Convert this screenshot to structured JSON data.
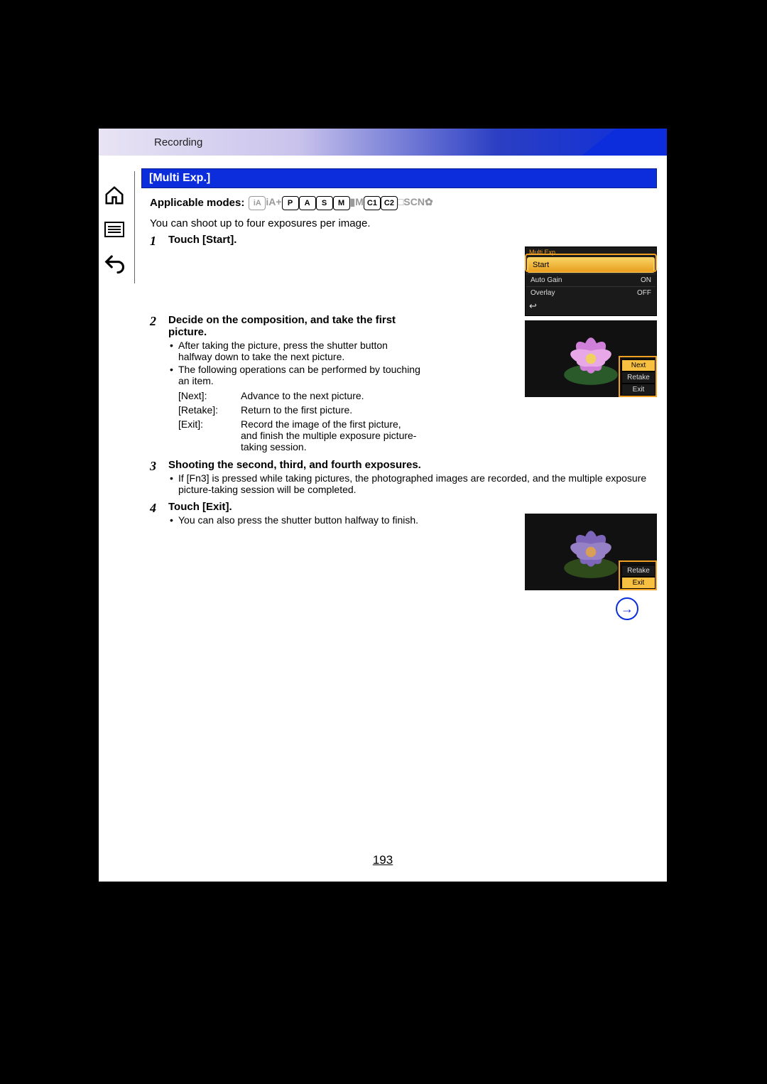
{
  "header": {
    "section": "Recording"
  },
  "title": "[Multi Exp.]",
  "modes_label": "Applicable modes:",
  "modes": [
    {
      "label": "iA",
      "on": false,
      "border": true
    },
    {
      "label": "iA+",
      "on": false,
      "border": false
    },
    {
      "label": "P",
      "on": true,
      "border": true
    },
    {
      "label": "A",
      "on": true,
      "border": true
    },
    {
      "label": "S",
      "on": true,
      "border": true
    },
    {
      "label": "M",
      "on": true,
      "border": true
    },
    {
      "label": "▮M",
      "on": false,
      "border": false
    },
    {
      "label": "C1",
      "on": true,
      "border": true
    },
    {
      "label": "C2",
      "on": true,
      "border": true
    },
    {
      "label": "□",
      "on": false,
      "border": false
    },
    {
      "label": "SCN",
      "on": false,
      "border": false
    },
    {
      "label": "✿",
      "on": false,
      "border": false
    }
  ],
  "description": "You can shoot up to four exposures per image.",
  "steps": [
    {
      "n": "1",
      "title": "Touch [Start]."
    },
    {
      "n": "2",
      "title": "Decide on the composition, and take the first picture.",
      "bullets": [
        "After taking the picture, press the shutter button halfway down to take the next picture.",
        "The following operations can be performed by touching an item."
      ],
      "defs": [
        {
          "k": "[Next]:",
          "v": "Advance to the next picture."
        },
        {
          "k": "[Retake]:",
          "v": "Return to the first picture."
        },
        {
          "k": "[Exit]:",
          "v": "Record the image of the first picture, and finish the multiple exposure picture-taking session."
        }
      ]
    },
    {
      "n": "3",
      "title": "Shooting the second, third, and fourth exposures.",
      "bullets": [
        "If [Fn3] is pressed while taking pictures, the photographed images are recorded, and the multiple exposure picture-taking session will be completed."
      ]
    },
    {
      "n": "4",
      "title": "Touch [Exit].",
      "bullets": [
        "You can also press the shutter button halfway to finish."
      ]
    }
  ],
  "camera_menu": {
    "title": "Multi Exp.",
    "start": "Start",
    "rows": [
      {
        "label": "Auto Gain",
        "value": "ON"
      },
      {
        "label": "Overlay",
        "value": "OFF"
      }
    ]
  },
  "preview1_buttons": {
    "next": "Next",
    "retake": "Retake",
    "exit": "Exit"
  },
  "preview2_buttons": {
    "retake": "Retake",
    "exit": "Exit"
  },
  "page_number": "193"
}
